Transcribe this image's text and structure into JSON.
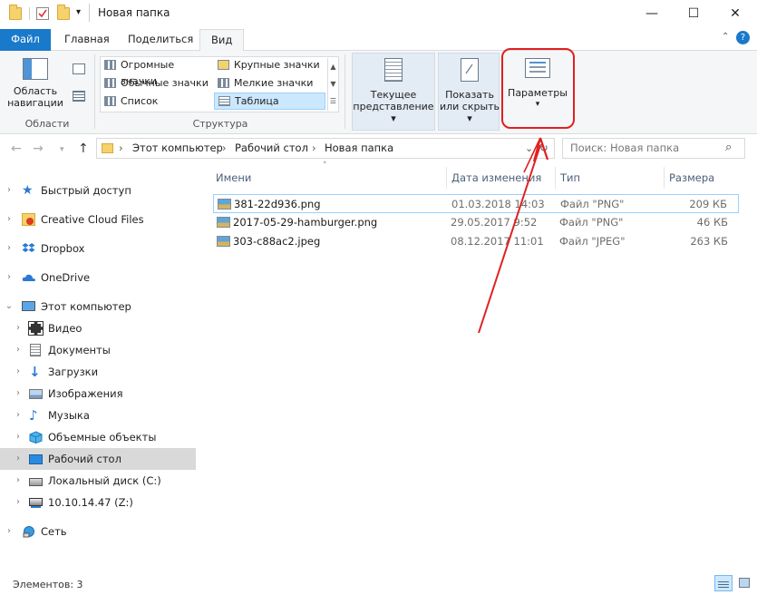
{
  "window": {
    "title": "Новая папка",
    "controls": {
      "minimize": "—",
      "maximize": "☐",
      "close": "✕"
    }
  },
  "ribbon_tabs": [
    "Файл",
    "Главная",
    "Поделиться",
    "Вид"
  ],
  "ribbon": {
    "areas_group": {
      "nav_pane_label_1": "Область",
      "nav_pane_label_2": "навигации",
      "group_label": "Области"
    },
    "layout_group": {
      "items": [
        "Огромные значки",
        "Крупные значки",
        "Обычные значки",
        "Мелкие значки",
        "Список",
        "Таблица"
      ],
      "selected": "Таблица",
      "group_label": "Структура"
    },
    "current_view": {
      "label_1": "Текущее",
      "label_2": "представление"
    },
    "show_hide": {
      "label_1": "Показать",
      "label_2": "или скрыть"
    },
    "options": {
      "label": "Параметры"
    }
  },
  "address": {
    "crumbs": [
      "Этот компьютер",
      "Рабочий стол",
      "Новая папка"
    ],
    "search_placeholder": "Поиск: Новая папка"
  },
  "nav": {
    "items": [
      {
        "label": "Быстрый доступ",
        "icon": "star-icon"
      },
      {
        "label": "Creative Cloud Files",
        "icon": "creative-cloud-icon"
      },
      {
        "label": "Dropbox",
        "icon": "dropbox-icon"
      },
      {
        "label": "OneDrive",
        "icon": "onedrive-icon"
      },
      {
        "label": "Этот компьютер",
        "icon": "computer-icon"
      },
      {
        "label": "Видео",
        "icon": "video-icon"
      },
      {
        "label": "Документы",
        "icon": "documents-icon"
      },
      {
        "label": "Загрузки",
        "icon": "downloads-icon"
      },
      {
        "label": "Изображения",
        "icon": "pictures-icon"
      },
      {
        "label": "Музыка",
        "icon": "music-icon"
      },
      {
        "label": "Объемные объекты",
        "icon": "3d-objects-icon"
      },
      {
        "label": "Рабочий стол",
        "icon": "desktop-icon"
      },
      {
        "label": "Локальный диск (C:)",
        "icon": "drive-icon"
      },
      {
        "label": "10.10.14.47 (Z:)",
        "icon": "network-drive-icon"
      },
      {
        "label": "Сеть",
        "icon": "network-icon"
      }
    ]
  },
  "file_list": {
    "columns": [
      "Имени",
      "Дата изменения",
      "Тип",
      "Размера"
    ],
    "rows": [
      {
        "name": "381-22d936.png",
        "date": "01.03.2018 14:03",
        "type": "Файл \"PNG\"",
        "size": "209 КБ"
      },
      {
        "name": "2017-05-29-hamburger.png",
        "date": "29.05.2017 9:52",
        "type": "Файл \"PNG\"",
        "size": "46 КБ"
      },
      {
        "name": "303-c88ac2.jpeg",
        "date": "08.12.2017 11:01",
        "type": "Файл \"JPEG\"",
        "size": "263 КБ"
      }
    ]
  },
  "status": {
    "items_count": "Элементов: 3"
  },
  "colors": {
    "file_tab": "#1979ca",
    "annotation": "#e02020",
    "selection": "#cce8ff"
  }
}
